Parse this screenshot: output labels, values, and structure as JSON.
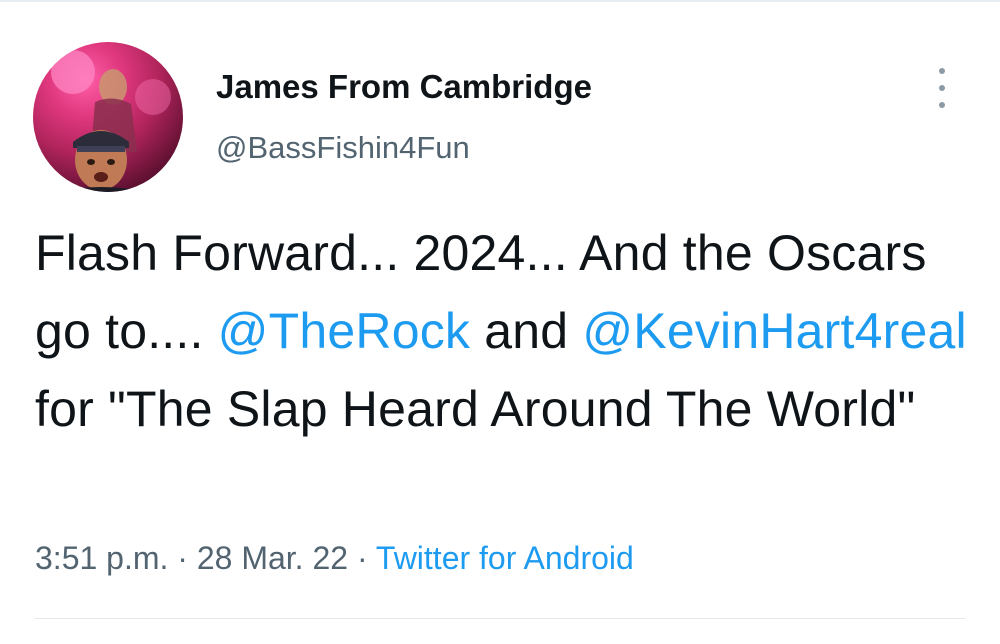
{
  "tweet": {
    "author": {
      "display_name": "James From Cambridge",
      "handle": "@BassFishin4Fun",
      "avatar_icon": "profile-photo"
    },
    "text": {
      "part1": "Flash Forward... 2024... And the Oscars go to.... ",
      "mention1": "@TheRock",
      "part2": " and ",
      "mention2": "@KevinHart4real",
      "part3": " for \"The Slap Heard Around The World\""
    },
    "meta": {
      "time": "3:51 p.m.",
      "separator1": " · ",
      "date": "28 Mar. 22",
      "separator2": " · ",
      "source": "Twitter for Android"
    },
    "more_icon": "more-vertical-icon"
  },
  "colors": {
    "text_primary": "#0f1419",
    "text_secondary": "#536471",
    "accent": "#1d9bf0"
  }
}
